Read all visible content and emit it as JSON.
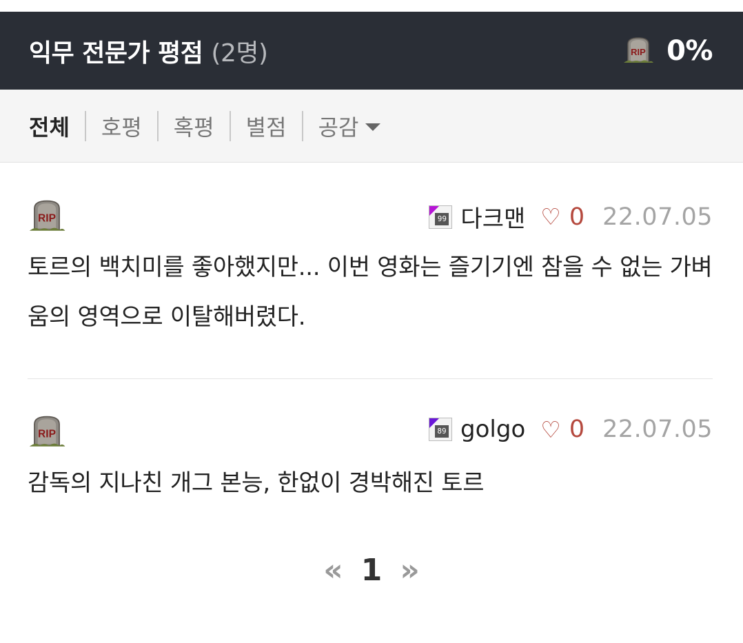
{
  "header": {
    "title": "익무 전문가 평점",
    "count": "(2명)",
    "score_icon": "rip-tombstone-icon",
    "score": "0%",
    "background": "#2a2e36"
  },
  "filters": {
    "tabs": [
      {
        "label": "전체",
        "active": true
      },
      {
        "label": "호평",
        "active": false
      },
      {
        "label": "혹평",
        "active": false
      },
      {
        "label": "별점",
        "active": false
      },
      {
        "label": "공감",
        "active": false
      }
    ]
  },
  "reviews": [
    {
      "rating_icon": "rip-tombstone-icon",
      "level": "99",
      "level_color": "#b615d6",
      "username": "다크맨",
      "likes": "0",
      "date": "22.07.05",
      "text": "토르의 백치미를 좋아했지만... 이번 영화는 즐기기엔 참을 수 없는 가벼움의 영역으로 이탈해버렸다."
    },
    {
      "rating_icon": "rip-tombstone-icon",
      "level": "89",
      "level_color": "#6a17d8",
      "username": "golgo",
      "likes": "0",
      "date": "22.07.05",
      "text": "감독의 지나친 개그 본능, 한없이 경박해진 토르"
    }
  ],
  "pagination": {
    "prev": "«",
    "current": "1",
    "next": "»"
  },
  "colors": {
    "accent_like": "#b5493e",
    "date_gray": "#a4a4a4"
  }
}
